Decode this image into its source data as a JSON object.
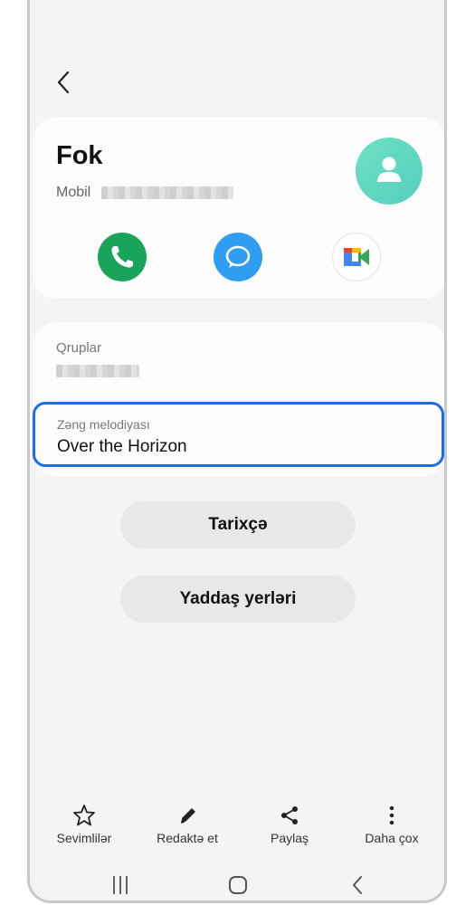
{
  "contact": {
    "name": "Fok",
    "phone_label": "Mobil"
  },
  "details": {
    "groups_label": "Qruplar",
    "ringtone_label": "Zəng melodiyası",
    "ringtone_value": "Over the Horizon"
  },
  "buttons": {
    "history": "Tarixçə",
    "storage": "Yaddaş yerləri"
  },
  "toolbar": {
    "favorites": "Sevimlilər",
    "edit": "Redaktə et",
    "share": "Paylaş",
    "more": "Daha çox"
  },
  "colors": {
    "accent": "#1c6ee8",
    "call": "#1aa45a",
    "message": "#2f9df2",
    "avatar": "#66dcc3"
  },
  "icons": [
    "back-icon",
    "person-icon",
    "phone-icon",
    "message-icon",
    "meet-icon",
    "star-icon",
    "pencil-icon",
    "share-icon",
    "more-icon",
    "recents-icon",
    "home-icon",
    "back-nav-icon"
  ]
}
